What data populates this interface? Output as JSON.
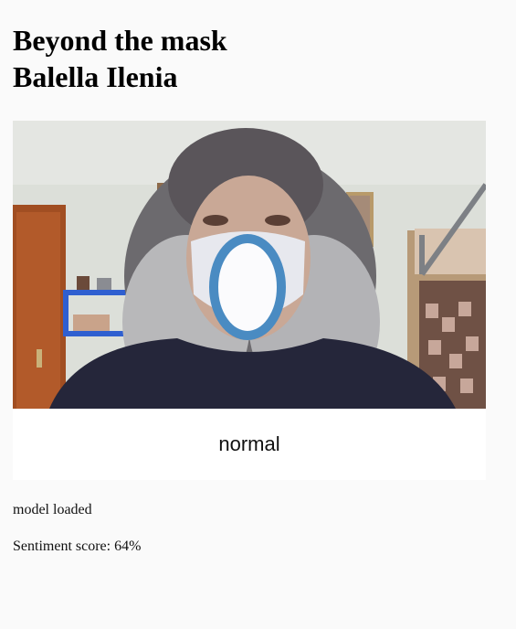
{
  "page": {
    "title_line1": "Beyond the mask",
    "title_line2": "Balella Ilenia"
  },
  "prediction": {
    "label": "normal"
  },
  "status": {
    "model_text": "model loaded",
    "sentiment_label": "Sentiment score: ",
    "sentiment_value": "64%"
  },
  "colors": {
    "overlay_ring": "#4a8bc2",
    "page_background": "#fafafa",
    "label_background": "#ffffff"
  },
  "icons": {
    "overlay": "mouth-overlay-ellipse"
  }
}
